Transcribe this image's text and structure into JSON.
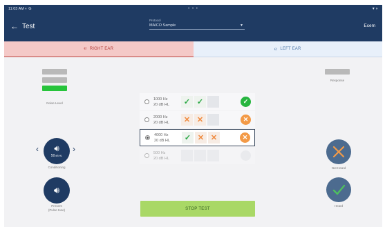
{
  "status_bar": {
    "time": "11:03 AM ◐ G",
    "dots": "• • •",
    "system": "▾ ◗"
  },
  "header": {
    "back_icon": "arrow-left-icon",
    "title": "Test",
    "protocol_label": "Protocol",
    "protocol_value": "MAICO Sample",
    "user": "Ecem"
  },
  "tabs": {
    "right": {
      "label": "RIGHT EAR",
      "icon": "ear-icon",
      "active": true,
      "color": "#b23a36"
    },
    "left": {
      "label": "LEFT EAR",
      "icon": "ear-icon",
      "active": false,
      "color": "#4d77a8"
    }
  },
  "left_panel": {
    "noise_level_label": "Noise Level",
    "conditioning_level": "50",
    "conditioning_unit": "dB HL",
    "conditioning_label": "Conditioning",
    "present_label_1": "Present",
    "present_label_2": "(Pulse tone)"
  },
  "right_panel": {
    "response_label": "Response",
    "not_heard_label": "Not Heard",
    "heard_label": "Heard"
  },
  "rows": [
    {
      "freq": "1000 Hz",
      "level": "20 dB HL",
      "cells": [
        "ok",
        "ok",
        "empty"
      ],
      "result": "ok",
      "selected": false,
      "dim": false
    },
    {
      "freq": "2000 Hz",
      "level": "20 dB HL",
      "cells": [
        "no",
        "no",
        "empty"
      ],
      "result": "no",
      "selected": false,
      "dim": false
    },
    {
      "freq": "4000 Hz",
      "level": "20 dB HL",
      "cells": [
        "ok",
        "no",
        "no"
      ],
      "result": "no",
      "selected": true,
      "dim": false
    },
    {
      "freq": "500 Hz",
      "level": "20 dB HL",
      "cells": [
        "empty",
        "empty",
        "empty"
      ],
      "result": "none",
      "selected": false,
      "dim": true
    }
  ],
  "stop_button": "STOP TEST",
  "colors": {
    "navy": "#1f3b63",
    "green": "#27b53f",
    "orange": "#f39a47",
    "stop_bg": "#a9d866"
  }
}
